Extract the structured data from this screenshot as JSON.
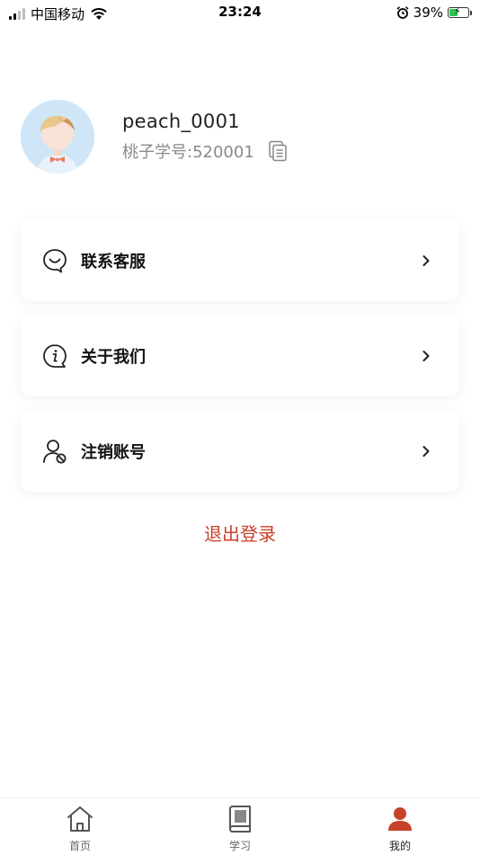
{
  "status_bar": {
    "carrier": "中国移动",
    "time": "23:24",
    "battery": "39%",
    "battery_level": 0.39
  },
  "profile": {
    "username": "peach_0001",
    "student_id": "桃子学号:520001"
  },
  "menu": [
    {
      "label": "联系客服",
      "icon": "chat-smile-icon"
    },
    {
      "label": "关于我们",
      "icon": "info-bubble-icon"
    },
    {
      "label": "注销账号",
      "icon": "user-cancel-icon"
    }
  ],
  "logout_label": "退出登录",
  "tabs": [
    {
      "label": "首页",
      "icon": "home-icon"
    },
    {
      "label": "学习",
      "icon": "book-icon"
    },
    {
      "label": "我的",
      "icon": "user-icon",
      "active": true
    }
  ],
  "colors": {
    "accent": "#c8412b",
    "avatar_bg": "#cfe6f8"
  }
}
